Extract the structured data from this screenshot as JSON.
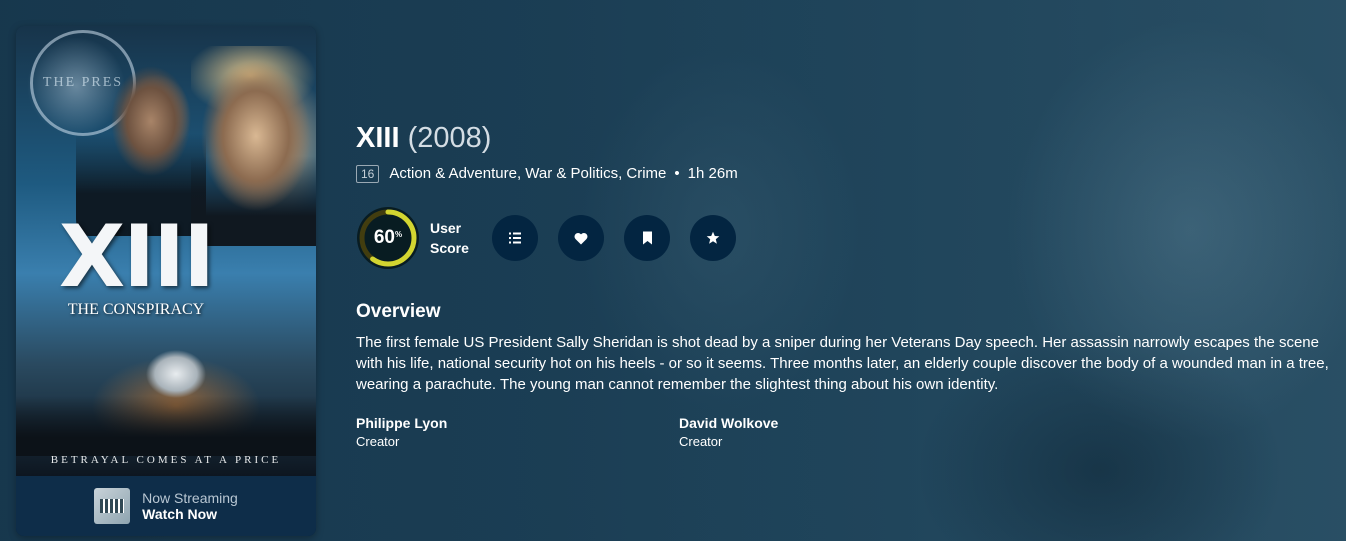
{
  "poster": {
    "seal_text": "THE PRES",
    "title_art": "XIII",
    "subtitle_art": "THE CONSPIRACY",
    "tagline": "BETRAYAL COMES AT A PRICE"
  },
  "streaming": {
    "status": "Now Streaming",
    "action": "Watch Now",
    "provider_icon": "provider-logo"
  },
  "movie": {
    "title": "XIII",
    "year": "(2008)",
    "certification": "16",
    "genres": "Action & Adventure, War & Politics, Crime",
    "runtime": "1h 26m",
    "separator": "•"
  },
  "score": {
    "value": 60,
    "display": "60",
    "percent_sign": "%",
    "label": "User Score",
    "ring_color": "#d2d531",
    "track_color": "#423d0f"
  },
  "actions": [
    {
      "name": "add-to-list",
      "icon": "list-icon"
    },
    {
      "name": "mark-as-favorite",
      "icon": "heart-icon"
    },
    {
      "name": "add-to-watchlist",
      "icon": "bookmark-icon"
    },
    {
      "name": "rate-it",
      "icon": "star-icon"
    }
  ],
  "overview": {
    "heading": "Overview",
    "text": "The first female US President Sally Sheridan is shot dead by a sniper during her Veterans Day speech. Her assassin narrowly escapes the scene with his life, national security hot on his heels - or so it seems. Three months later, an elderly couple discover the body of a wounded man in a tree, wearing a parachute. The young man cannot remember the slightest thing about his own identity."
  },
  "crew": [
    {
      "name": "Philippe Lyon",
      "role": "Creator"
    },
    {
      "name": "David Wolkove",
      "role": "Creator"
    }
  ],
  "colors": {
    "background": "#1d4158",
    "button_bg": "#032541"
  }
}
